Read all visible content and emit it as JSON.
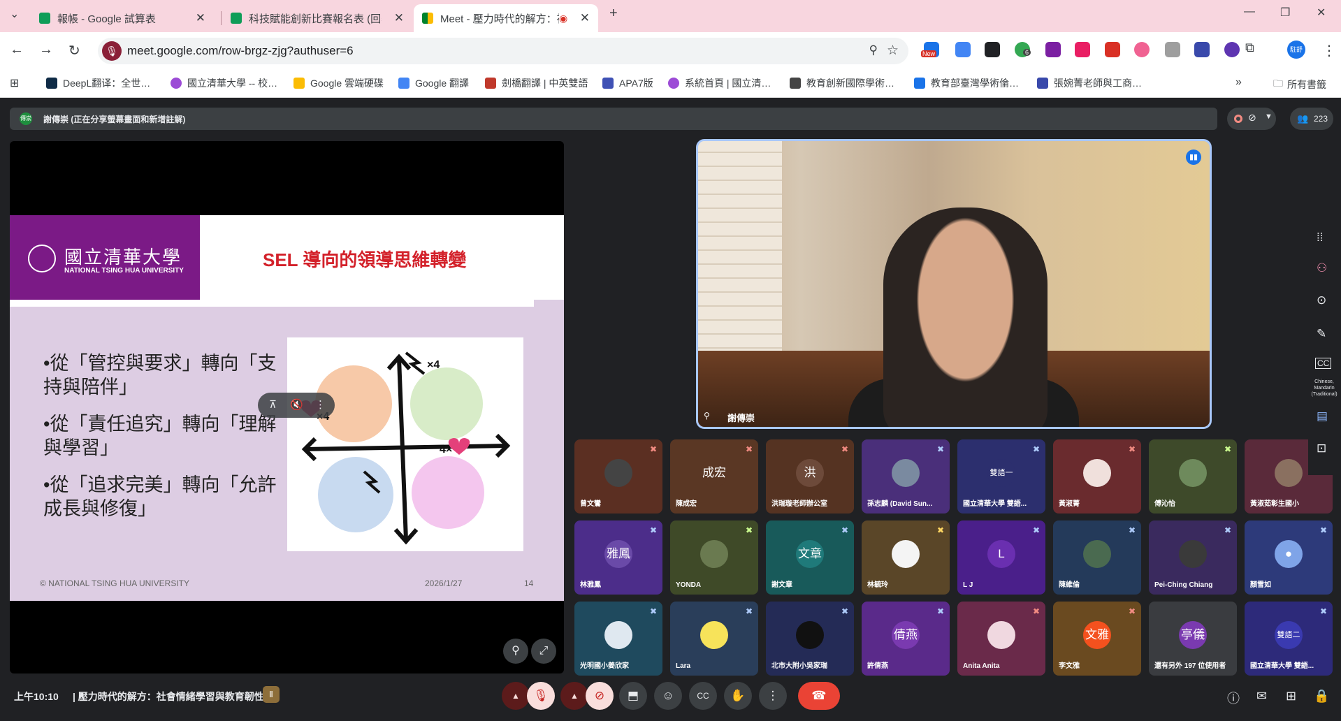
{
  "browser": {
    "tabs": [
      {
        "title": "報帳 - Google 試算表",
        "color": "#0f9d58"
      },
      {
        "title": "科技賦能創新比賽報名表 (回覆)",
        "color": "#0f9d58"
      },
      {
        "title": "Meet - 壓力時代的解方：社",
        "color": "#1e8e3e"
      }
    ],
    "new_tab": "+",
    "window_controls": {
      "min": "—",
      "max": "❐",
      "close": "✕"
    },
    "url": "meet.google.com/row-brgz-zjg?authuser=6",
    "ext_badge_new": "New",
    "ext_badge_count": "6",
    "profile": "駐舒",
    "bookmarks": [
      {
        "label": "DeepL翻译：全世…",
        "color": "#0f2b46"
      },
      {
        "label": "國立清華大學 -- 校…",
        "color": "#9c4bd6"
      },
      {
        "label": "Google 雲端硬碟",
        "color": "#fbbc04"
      },
      {
        "label": "Google 翻譯",
        "color": "#4285f4"
      },
      {
        "label": "劍橋翻譯 | 中英雙語",
        "color": "#c0392b"
      },
      {
        "label": "APA7版",
        "color": "#3f51b5"
      },
      {
        "label": "系統首頁 | 國立清…",
        "color": "#9c4bd6"
      },
      {
        "label": "教育創新國際學術…",
        "color": "#444"
      },
      {
        "label": "教育部臺灣學術倫…",
        "color": "#1a73e8"
      },
      {
        "label": "張婉菁老師與工商…",
        "color": "#3949ab"
      }
    ],
    "bookmarks_more": "»",
    "all_bookmarks": "所有書籤"
  },
  "meet": {
    "presenter_avatar": "傳崇",
    "presenter_banner": "謝傳崇 (正在分享螢幕畫面和新增註解)",
    "participant_count": "223",
    "slide": {
      "univ_cn": "國立清華大學",
      "univ_en": "NATIONAL TSING HUA UNIVERSITY",
      "title": "SEL 導向的領導思維轉變",
      "bullets": [
        "•從「管控與要求」轉向「支持與陪伴」",
        "•從「責任追究」轉向「理解與學習」",
        "•從「追求完美」轉向「允許成長與修復」"
      ],
      "quad_labels": {
        "tr": "×4",
        "tl": "×4",
        "br": "4×"
      },
      "footer_left": "© NATIONAL TSING HUA UNIVERSITY",
      "footer_date": "2026/1/27",
      "footer_page": "14"
    },
    "speaker": {
      "name": "謝傳崇"
    },
    "tiles": [
      {
        "name": "曾文鸞",
        "bg": "#5b2f22",
        "kind": "img",
        "avatar_bg": "#444",
        "mute": "#f28b82"
      },
      {
        "name": "陳成宏",
        "bg": "#5a3724",
        "kind": "text",
        "avatar": "成宏",
        "avatar_bg": "#5a3724",
        "mute": "#f28b82"
      },
      {
        "name": "洪瑞璇老師辦公室",
        "bg": "#553322",
        "kind": "text",
        "avatar": "洪",
        "avatar_bg": "#6d4a3a",
        "mute": "#f28b82"
      },
      {
        "name": "孫志麟 (David Sun...",
        "bg": "#4a2f7a",
        "kind": "img",
        "avatar_bg": "#7a8aa0",
        "mute": "#aecbfa"
      },
      {
        "name": "國立清華大學 雙語...",
        "bg": "#2c2f6e",
        "kind": "text",
        "avatar": "雙語一",
        "avatar_bg": "#2c2f6e",
        "mute": "#aecbfa"
      },
      {
        "name": "黃淑菁",
        "bg": "#6a2b2e",
        "kind": "img",
        "avatar_bg": "#f0e0dc",
        "mute": "#f28b82"
      },
      {
        "name": "傅沁怡",
        "bg": "#3e4a2a",
        "kind": "img",
        "avatar_bg": "#6e8a5c",
        "mute": "#ccff90"
      },
      {
        "name": "黃淑茹彰生國小",
        "bg": "#5a2a3a",
        "kind": "img",
        "avatar_bg": "#8a7060",
        "mute": "#f28b82"
      },
      {
        "name": "林雅鳳",
        "bg": "#4c2d8a",
        "kind": "text",
        "avatar": "雅鳳",
        "avatar_bg": "#6a4aa8",
        "mute": "#aecbfa"
      },
      {
        "name": "YONDA",
        "bg": "#3f4a28",
        "kind": "img",
        "avatar_bg": "#6a7a50",
        "mute": "#ccff90"
      },
      {
        "name": "謝文章",
        "bg": "#185a5a",
        "kind": "text",
        "avatar": "文章",
        "avatar_bg": "#1f7a7a",
        "mute": "#aecbfa"
      },
      {
        "name": "林毓玲",
        "bg": "#5a4628",
        "kind": "img",
        "avatar_bg": "#f4f4f4",
        "mute": "#fdd663"
      },
      {
        "name": "L J",
        "bg": "#4a1f8a",
        "kind": "text",
        "avatar": "L",
        "avatar_bg": "#6a2fb0",
        "mute": "#aecbfa"
      },
      {
        "name": "陳維倫",
        "bg": "#243a5a",
        "kind": "img",
        "avatar_bg": "#4a6a50",
        "mute": "#aecbfa"
      },
      {
        "name": "Pei-Ching Chiang",
        "bg": "#3a2a5e",
        "kind": "img",
        "avatar_bg": "#3a3a3a",
        "mute": "#aecbfa"
      },
      {
        "name": "顏雪如",
        "bg": "#2d3a7a",
        "kind": "text",
        "avatar": "●",
        "avatar_bg": "#7fa4e8",
        "mute": "#aecbfa"
      },
      {
        "name": "光明國小姜欣家",
        "bg": "#1f4a5e",
        "kind": "img",
        "avatar_bg": "#dfe8f0",
        "mute": "#aecbfa"
      },
      {
        "name": "Lara",
        "bg": "#2a3e5a",
        "kind": "img",
        "avatar_bg": "#f7e35a",
        "mute": "#aecbfa"
      },
      {
        "name": "北市大附小吳家瑞",
        "bg": "#242b56",
        "kind": "img",
        "avatar_bg": "#111",
        "mute": "#aecbfa"
      },
      {
        "name": "許倩燕",
        "bg": "#5a2a8a",
        "kind": "text",
        "avatar": "倩燕",
        "avatar_bg": "#7a3ab0",
        "mute": "#aecbfa"
      },
      {
        "name": "Anita Anita",
        "bg": "#6a2a4a",
        "kind": "img",
        "avatar_bg": "#f0d8e0",
        "mute": "#f28b82"
      },
      {
        "name": "李文雅",
        "bg": "#6a4a20",
        "kind": "text",
        "avatar": "文雅",
        "avatar_bg": "#f4511e",
        "mute": "#f28b82"
      },
      {
        "name": "還有另外 197 位使用者",
        "bg": "#3a3c40",
        "kind": "text",
        "avatar": "亭儀",
        "avatar_bg": "#7a3ab0",
        "mute": ""
      },
      {
        "name": "國立清華大學 雙語...",
        "bg": "#2d2a7a",
        "kind": "text",
        "avatar": "雙語二",
        "avatar_bg": "#3a3ab0",
        "mute": "#aecbfa"
      }
    ],
    "rail_caption": "Chinese, Mandarin (Traditional)",
    "time": "上午10:10",
    "meeting_title": "|  壓力時代的解方：社會情緒學習與教育韌性",
    "badge": "Ⅱ"
  },
  "colors": {
    "accent": "#1a73e8",
    "hangup": "#ea4335",
    "slide_title": "#d3212a",
    "univ_purple": "#7b1a86"
  }
}
